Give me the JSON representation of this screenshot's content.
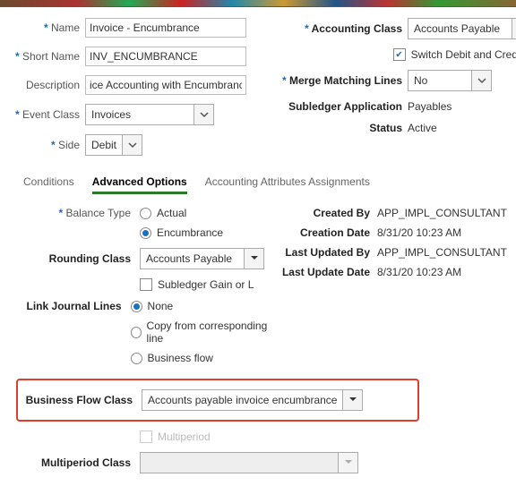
{
  "header": {
    "name_label": "Name",
    "name_value": "Invoice - Encumbrance",
    "short_name_label": "Short Name",
    "short_name_value": "INV_ENCUMBRANCE",
    "description_label": "Description",
    "description_value": "ice Accounting with Encumbrance",
    "event_class_label": "Event Class",
    "event_class_value": "Invoices",
    "side_label": "Side",
    "side_value": "Debit",
    "accounting_class_label": "Accounting Class",
    "accounting_class_value": "Accounts Payable",
    "switch_label": "Switch Debit and Credit",
    "merge_label": "Merge Matching Lines",
    "merge_value": "No",
    "subledger_app_label": "Subledger Application",
    "subledger_app_value": "Payables",
    "status_label": "Status",
    "status_value": "Active"
  },
  "tabs": {
    "conditions": "Conditions",
    "advanced": "Advanced Options",
    "attrs": "Accounting Attributes Assignments"
  },
  "adv": {
    "balance_type_label": "Balance Type",
    "balance_actual": "Actual",
    "balance_encumbrance": "Encumbrance",
    "rounding_class_label": "Rounding Class",
    "rounding_class_value": "Accounts Payable",
    "subledger_gain_label": "Subledger Gain or L",
    "link_label": "Link Journal Lines",
    "link_none": "None",
    "link_copy": "Copy from corresponding line",
    "link_flow": "Business flow",
    "bfc_label": "Business Flow Class",
    "bfc_value": "Accounts payable invoice encumbrance",
    "multiperiod_chk": "Multiperiod",
    "multiperiod_class_label": "Multiperiod Class",
    "multiperiod_class_value": ""
  },
  "meta": {
    "created_by_label": "Created By",
    "created_by": "APP_IMPL_CONSULTANT",
    "creation_date_label": "Creation Date",
    "creation_date": "8/31/20 10:23 AM",
    "lub_label": "Last Updated By",
    "lub": "APP_IMPL_CONSULTANT",
    "lud_label": "Last Update Date",
    "lud": "8/31/20 10:23 AM"
  }
}
